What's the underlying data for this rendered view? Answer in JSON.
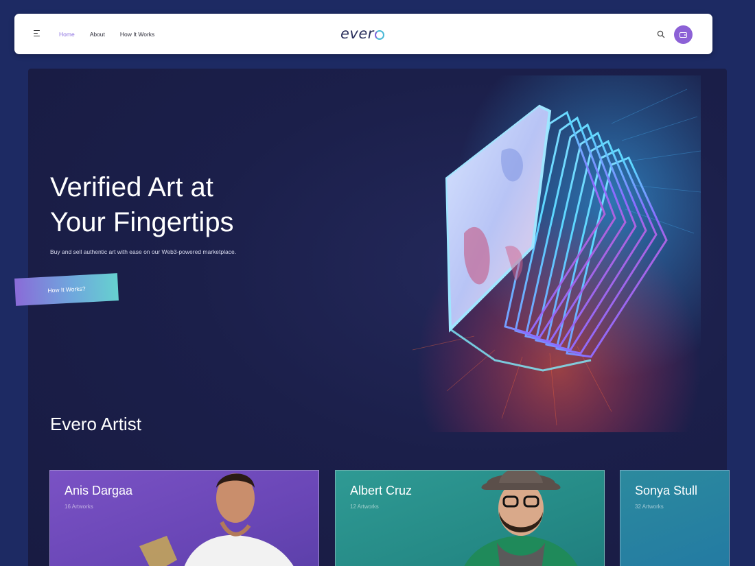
{
  "nav": {
    "links": [
      "Home",
      "About",
      "How It Works"
    ],
    "active": "Home",
    "logo": "evero",
    "icons": [
      "menu-icon",
      "search-icon",
      "wallet-icon"
    ]
  },
  "hero": {
    "title_line1": "Verified Art at",
    "title_line2": "Your Fingertips",
    "subtitle": "Buy and sell authentic art with ease on our Web3-powered marketplace.",
    "cta": "How It Works?"
  },
  "artists": {
    "section_title": "Evero Artist",
    "items": [
      {
        "name": "Anis Dargaa",
        "count": "16 Artworks"
      },
      {
        "name": "Albert Cruz",
        "count": "12 Artworks"
      },
      {
        "name": "Sonya Stull",
        "count": "32 Artworks"
      }
    ]
  },
  "colors": {
    "background": "#1d2a63",
    "hero_bg": "#1b1f4a",
    "accent": "#8c61d6",
    "teal": "#66d1cf",
    "card_purple": "#6946b6",
    "card_teal": "#258a86",
    "card_blue": "#2279a3"
  }
}
